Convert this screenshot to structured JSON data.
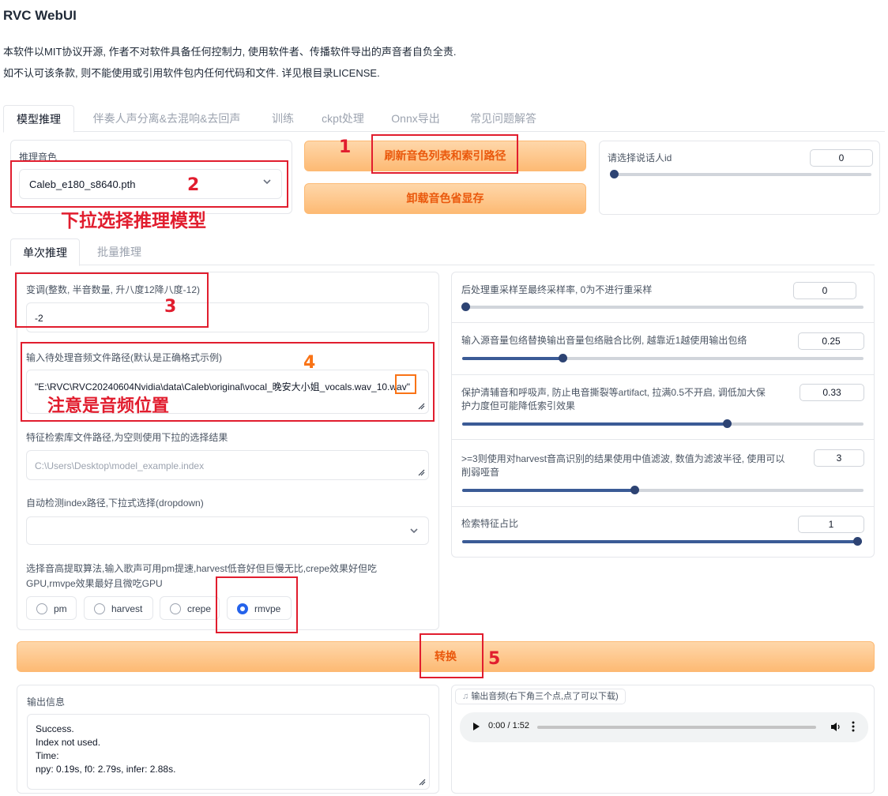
{
  "app": {
    "title": "RVC WebUI",
    "desc_line1": "本软件以MIT协议开源, 作者不对软件具备任何控制力, 使用软件者、传播软件导出的声音者自负全责.",
    "desc_line2": "如不认可该条款, 则不能使用或引用软件包内任何代码和文件. 详见根目录LICENSE."
  },
  "tabs": [
    "模型推理",
    "伴奏人声分离&去混响&去回声",
    "训练",
    "ckpt处理",
    "Onnx导出",
    "常见问题解答"
  ],
  "model": {
    "label": "推理音色",
    "selected": "Caleb_e180_s8640.pth",
    "refresh_button": "刷新音色列表和索引路径",
    "unload_button": "卸载音色省显存",
    "speaker_label": "请选择说话人id",
    "speaker_value": "0",
    "speaker_fraction": 0.0
  },
  "subtabs": [
    "单次推理",
    "批量推理"
  ],
  "left": {
    "transpose_label": "变调(整数, 半音数量, 升八度12降八度-12)",
    "transpose_value": "-2",
    "input_path_label": "输入待处理音频文件路径(默认是正确格式示例)",
    "input_path_value": "\"E:\\RVC\\RVC20240604Nvidia\\data\\Caleb\\original\\vocal_晚安大小姐_vocals.wav_10.wav\"",
    "index_path_label": "特征检索库文件路径,为空则使用下拉的选择结果",
    "index_path_placeholder": "C:\\Users\\Desktop\\model_example.index",
    "auto_index_label": "自动检测index路径,下拉式选择(dropdown)",
    "auto_index_value": "",
    "f0_label_line1": "选择音高提取算法,输入歌声可用pm提速,harvest低音好但巨慢无比,crepe效果好但吃",
    "f0_label_line2": "GPU,rmvpe效果最好且微吃GPU",
    "f0_options": [
      "pm",
      "harvest",
      "crepe",
      "rmvpe"
    ],
    "f0_selected": "rmvpe"
  },
  "right": {
    "resample_label": "后处理重采样至最终采样率, 0为不进行重采样",
    "resample_value": "0",
    "resample_fraction": 0.0,
    "rms_label": "输入源音量包络替换输出音量包络融合比例, 越靠近1越使用输出包络",
    "rms_value": "0.25",
    "rms_fraction": 0.25,
    "protect_label_line1": "保护清辅音和呼吸声, 防止电音撕裂等artifact, 拉满0.5不开启, 调低加大保",
    "protect_label_line2": "护力度但可能降低索引效果",
    "protect_value": "0.33",
    "protect_fraction": 0.66,
    "filter_label_line1": ">=3则使用对harvest音高识别的结果使用中值滤波, 数值为滤波半径, 使用可以",
    "filter_label_line2": "削弱哑音",
    "filter_value": "3",
    "filter_fraction": 0.43,
    "index_rate_label": "检索特征占比",
    "index_rate_value": "1",
    "index_rate_fraction": 1.0
  },
  "convert_button": "转换",
  "output": {
    "info_label": "输出信息",
    "info_lines": [
      "Success.",
      "Index not used.",
      "Time:",
      "npy: 0.19s, f0: 2.79s, infer: 2.88s."
    ],
    "audio_label": "输出音频(右下角三个点,点了可以下载)",
    "audio_time": "0:00 / 1:52",
    "audio_progress_fraction": 0.0
  },
  "annotations": {
    "n1": "1",
    "n2": "2",
    "n2_text": "下拉选择推理模型",
    "n3": "3",
    "n4": "4",
    "n4_text": "注意是音频位置",
    "n5": "5",
    "red": "#e11d2e",
    "orange": "#f97316"
  },
  "colors": {
    "accent_orange": "#ea580c",
    "slider": "#3b5b96",
    "radio_selected": "#2563eb"
  }
}
